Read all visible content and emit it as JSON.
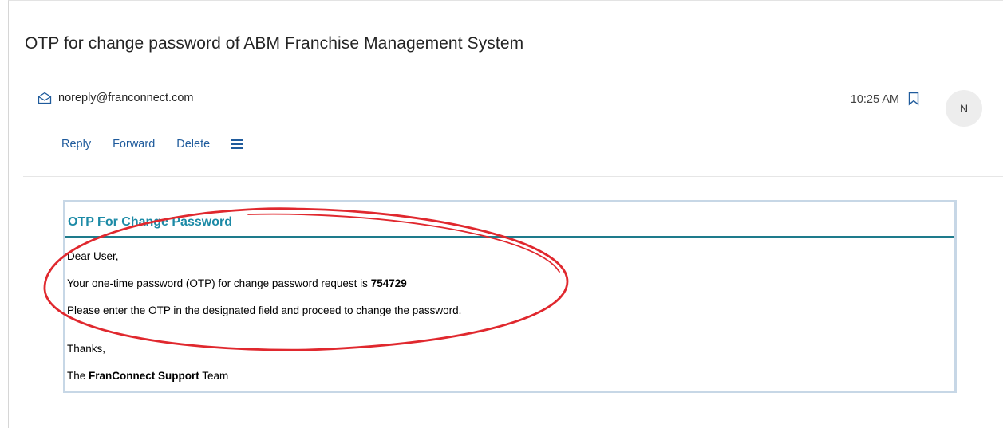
{
  "email": {
    "subject": "OTP for change password of ABM Franchise Management System",
    "sender": "noreply@franconnect.com",
    "time": "10:25 AM",
    "avatar_initial": "N"
  },
  "actions": {
    "reply": "Reply",
    "forward": "Forward",
    "delete": "Delete"
  },
  "body": {
    "title": "OTP For Change Password",
    "greeting": "Dear User,",
    "otp_prefix": "Your one-time password (OTP) for change password request is ",
    "otp_code": "754729",
    "instruction": "Please enter the OTP in the designated field and proceed to change the password.",
    "thanks": "Thanks,",
    "sign_prefix": "The ",
    "sign_bold": "FranConnect Support",
    "sign_suffix": " Team"
  },
  "colors": {
    "link": "#1f5b9c",
    "title": "#1c8aa6",
    "annotation": "#e0282e"
  }
}
